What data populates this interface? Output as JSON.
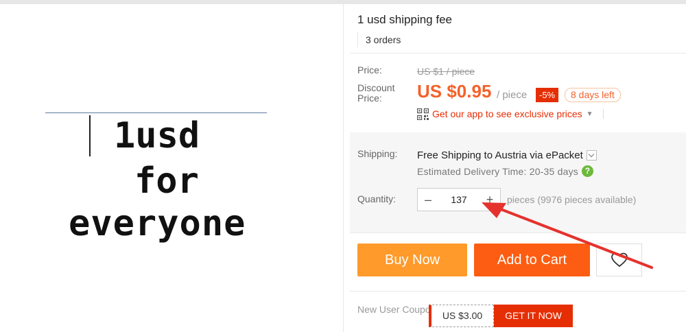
{
  "product": {
    "title": "1 usd shipping fee",
    "orders": "3 orders",
    "image_text": [
      "1usd",
      "for",
      "everyone"
    ]
  },
  "price": {
    "label": "Price:",
    "original": "US $1 / piece",
    "discount_label": "Discount Price:",
    "current": "US $0.95",
    "unit": "/ piece",
    "discount_badge": "-5%",
    "days_left": "8 days left"
  },
  "app_promo": {
    "text": "Get our app to see exclusive prices",
    "icon": "qr-code-icon"
  },
  "shipping": {
    "label": "Shipping:",
    "method": "Free Shipping to Austria via ePacket",
    "estimate": "Estimated Delivery Time: 20-35 days",
    "help_glyph": "?"
  },
  "quantity": {
    "label": "Quantity:",
    "value": "137",
    "minus": "–",
    "plus": "+",
    "available": "pieces (9976 pieces available)"
  },
  "actions": {
    "buy_now": "Buy Now",
    "add_to_cart": "Add to Cart",
    "wishlist_icon": "heart-icon"
  },
  "coupon": {
    "label": "New User Coupon:",
    "value": "US $3.00",
    "button": "GET IT NOW"
  },
  "colors": {
    "accent": "#fd5d12",
    "price": "#f4612b",
    "red": "#e62e04",
    "buy_now": "#ff9a2b",
    "annotation_arrow": "#e5322d"
  }
}
